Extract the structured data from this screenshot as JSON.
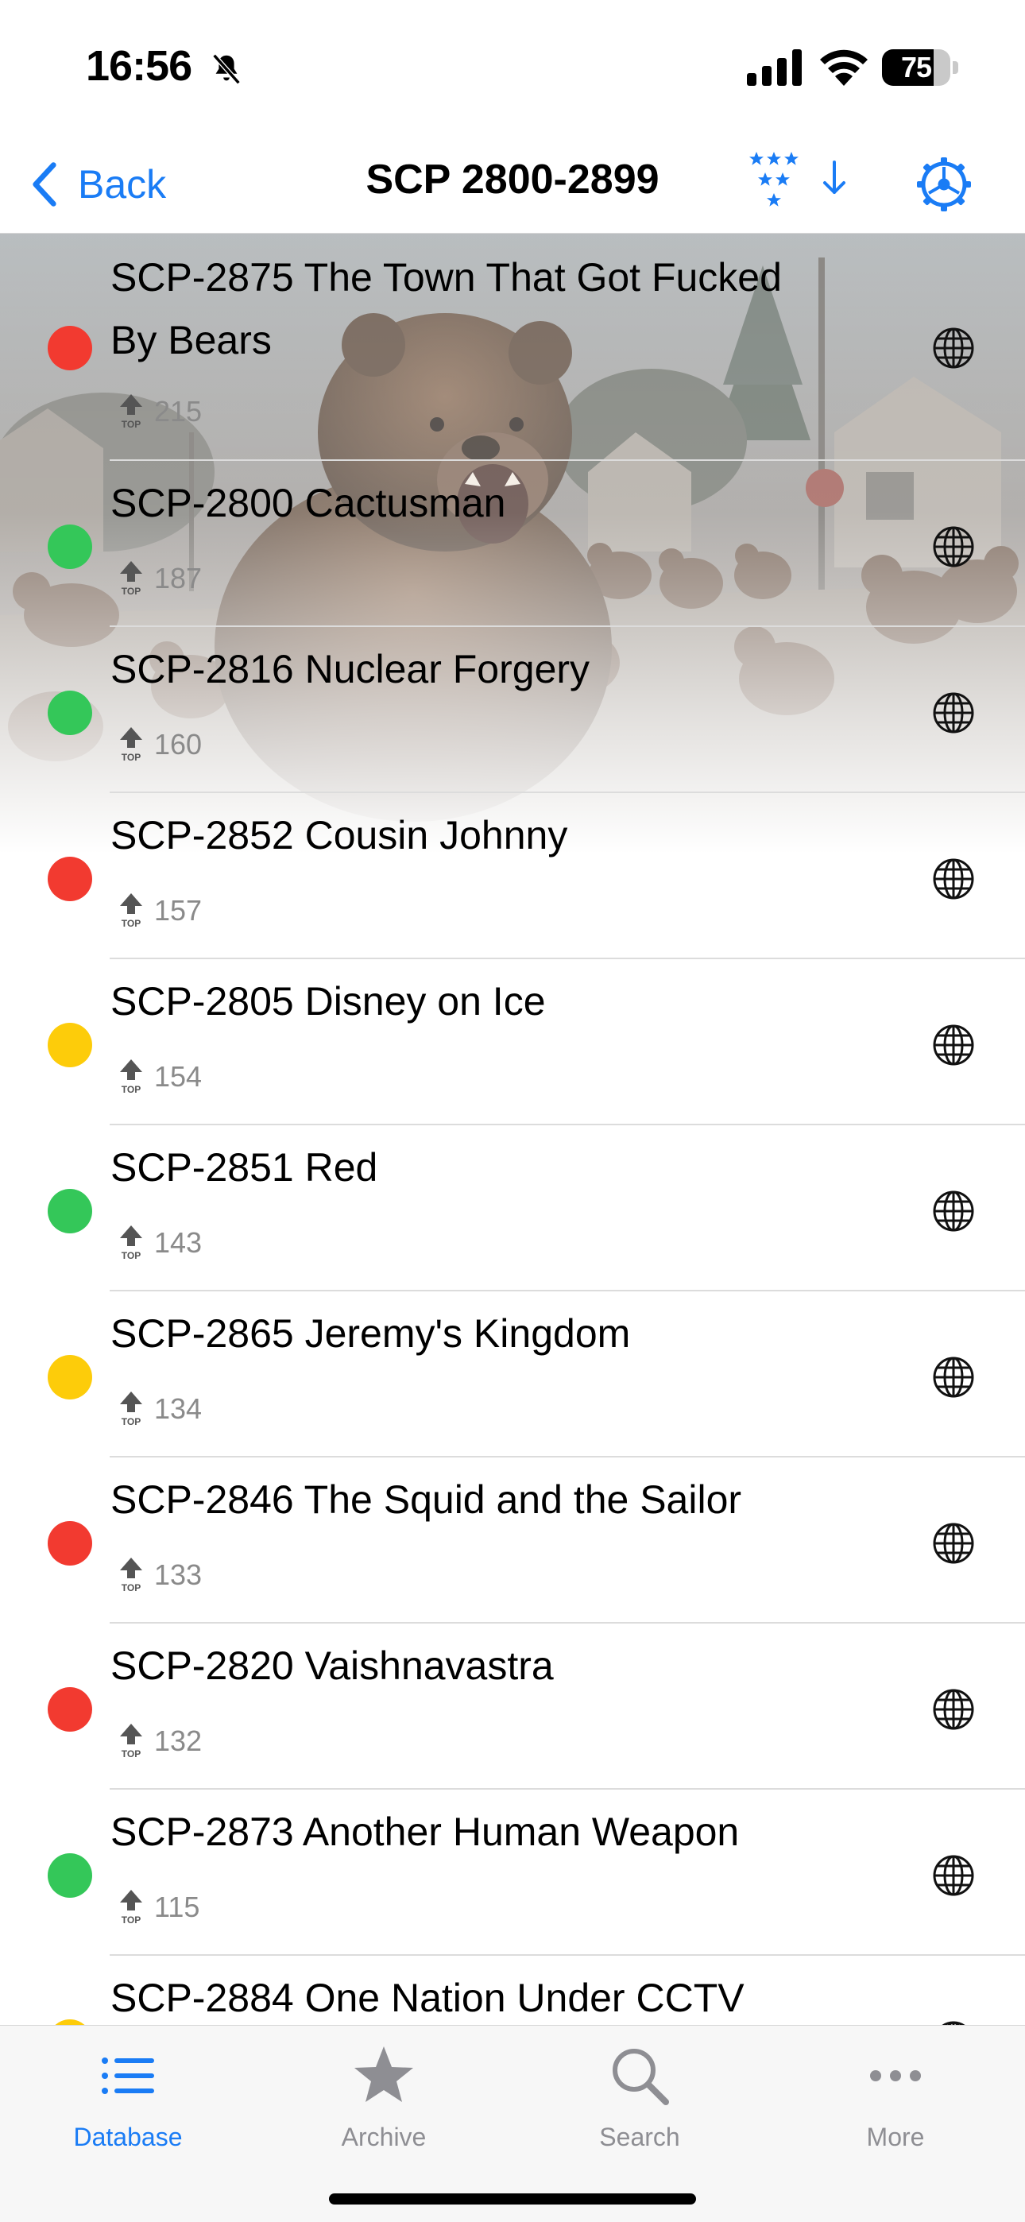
{
  "status_bar": {
    "time": "16:56",
    "battery_level": "75",
    "battery_fraction": 0.75
  },
  "nav": {
    "back_label": "Back",
    "title": "SCP 2800-2899"
  },
  "colors": {
    "accent": "#1a7cf5",
    "red": "#f23a30",
    "green": "#34c759",
    "yellow": "#fdcc0a"
  },
  "items": [
    {
      "title": "SCP-2875 The Town That Got Fucked By Bears",
      "rating": "215",
      "status": "red"
    },
    {
      "title": "SCP-2800 Cactusman",
      "rating": "187",
      "status": "green"
    },
    {
      "title": "SCP-2816 Nuclear Forgery",
      "rating": "160",
      "status": "green"
    },
    {
      "title": "SCP-2852 Cousin Johnny",
      "rating": "157",
      "status": "red"
    },
    {
      "title": "SCP-2805 Disney on Ice",
      "rating": "154",
      "status": "yellow"
    },
    {
      "title": "SCP-2851 Red",
      "rating": "143",
      "status": "green"
    },
    {
      "title": "SCP-2865 Jeremy's Kingdom",
      "rating": "134",
      "status": "yellow"
    },
    {
      "title": "SCP-2846 The Squid and the Sailor",
      "rating": "133",
      "status": "red"
    },
    {
      "title": "SCP-2820 Vaishnavastra",
      "rating": "132",
      "status": "red"
    },
    {
      "title": "SCP-2873 Another Human Weapon",
      "rating": "115",
      "status": "green"
    },
    {
      "title": "SCP-2884 One Nation Under CCTV",
      "rating": "",
      "status": "yellow"
    }
  ],
  "tabs": [
    {
      "label": "Database",
      "icon": "list-icon",
      "active": true
    },
    {
      "label": "Archive",
      "icon": "star-icon",
      "active": false
    },
    {
      "label": "Search",
      "icon": "search-icon",
      "active": false
    },
    {
      "label": "More",
      "icon": "more-icon",
      "active": false
    }
  ]
}
